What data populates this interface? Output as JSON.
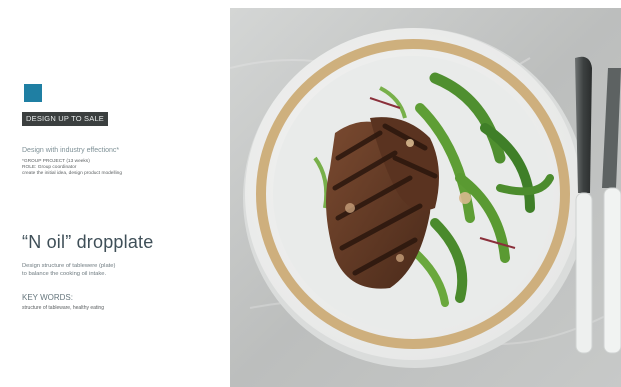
{
  "logo": {
    "text": ""
  },
  "tag": "DESIGN UP TO SALE",
  "subtitle": "Design with industry effectionc*",
  "meta": [
    "*GROUP PROJECT (13 weeks)",
    "ROLE: Group coordinator",
    "create the initial idea, design product modelling"
  ],
  "title": "“N oil” dropplate",
  "description": [
    "Design structure of tablewere (plate)",
    "to balance the cooking oil intake."
  ],
  "keywords_label": "KEY WORDS:",
  "keywords": "structure of tableware, healthy eating",
  "colors": {
    "tag_bg": "#3b3f3f",
    "logo": "#1f7fa3",
    "plate_rim": "#c9a56a"
  }
}
